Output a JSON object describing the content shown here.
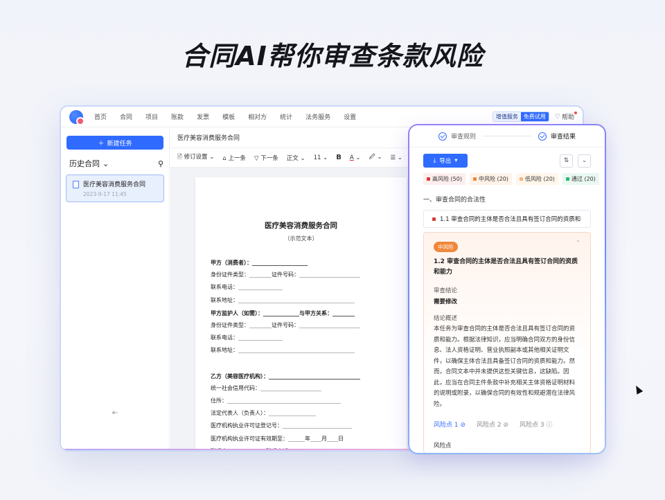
{
  "hero": {
    "title": "合同AI帮你审查条款风险"
  },
  "nav": {
    "items": [
      "首页",
      "合同",
      "项目",
      "账款",
      "发票",
      "模板",
      "相对方",
      "统计",
      "法务服务",
      "设置"
    ],
    "vip_label": "增值服务",
    "trial_label": "免费试用",
    "help_label": "帮助"
  },
  "sidebar": {
    "new_task": "新建任务",
    "history_label": "历史合同",
    "item_title": "医疗美容消费服务合同",
    "item_date": "2023-9-17 11:45",
    "collapse": "⇤"
  },
  "editor": {
    "tab_title": "医疗美容消费服务合同",
    "toolbar": {
      "revise": "修订设置",
      "prev": "上一条",
      "next": "下一条",
      "style": "正文",
      "size": "11",
      "bold": "B",
      "font_color": "A",
      "highlight": "🖉"
    }
  },
  "document": {
    "title": "医疗美容消费服务合同",
    "subtitle": "（示范文本）",
    "lines": [
      {
        "t": "甲方（消费者）：____________________",
        "b": true
      },
      {
        "t": "身份证件类型：________证件号码：______________________",
        "b": false
      },
      {
        "t": "联系电话：________________",
        "b": false
      },
      {
        "t": "联系地址：__________________________________________",
        "b": false
      },
      {
        "t": "甲方监护人（如需）：_____________与甲方关系：________",
        "b": true
      },
      {
        "t": "身份证件类型：________证件号码：______________________",
        "b": false
      },
      {
        "t": "联系电话：________________",
        "b": false
      },
      {
        "t": "联系地址：__________________________________________",
        "b": false
      },
      {
        "t": "",
        "b": false
      },
      {
        "t": "乙方（美容医疗机构）：_________________________________",
        "b": true
      },
      {
        "t": "统一社会信用代码：______________________",
        "b": false
      },
      {
        "t": "住所：_________________________________________",
        "b": false
      },
      {
        "t": "法定代表人（负责人）：_________________",
        "b": false
      },
      {
        "t": "医疗机构执业许可证登记号：_________________________",
        "b": false
      },
      {
        "t": "医疗机构执业许可证有效期至：______年____月____日",
        "b": false
      },
      {
        "t": "联系人：____________联系电话：______________",
        "b": false
      }
    ]
  },
  "panel": {
    "tab_rules": "审查规则",
    "tab_results": "审查结果",
    "export": "导出",
    "chips": [
      {
        "label": "高风险 (50)",
        "color": "#d83a3a",
        "bg": "#fdeeee"
      },
      {
        "label": "中风险 (20)",
        "color": "#f0873a",
        "bg": "#fff2e8"
      },
      {
        "label": "低风险 (20)",
        "color": "#f5b37a",
        "bg": "#fff5ea"
      },
      {
        "label": "通过 (20)",
        "color": "#2bb673",
        "bg": "#e9f8f0"
      }
    ],
    "section": "一、审查合同的合法性",
    "row1": "1.1 审查合同的主体是否合法且具有签订合同的资质和",
    "card": {
      "tag": "中风险",
      "title": "1.2 审查合同的主体是否合法且具有签订合同的资质和能力",
      "conclusion_label": "审查结论",
      "conclusion": "需要修改",
      "summary_label": "结论概述",
      "summary": "本任务为审查合同的主体是否合法且具有签订合同的资质和能力。根据法律知识，应当明确合同双方的身份信息、法人资格证明、营业执照副本或其他相关证明文件，以确保主体合法且具备签订合同的资质和能力。然而，合同文本中并未提供这些关键信息，这缺陷。因此，应当在合同主件条款中补充相关主体资格证明材料的说明或附录，以确保合同的有效性和规避潜在法律风险。",
      "risk_tabs": [
        "风险点 1 ⊘",
        "风险点 2 ⊘",
        "风险点 3 ⓘ"
      ],
      "risk_label": "风险点"
    }
  }
}
